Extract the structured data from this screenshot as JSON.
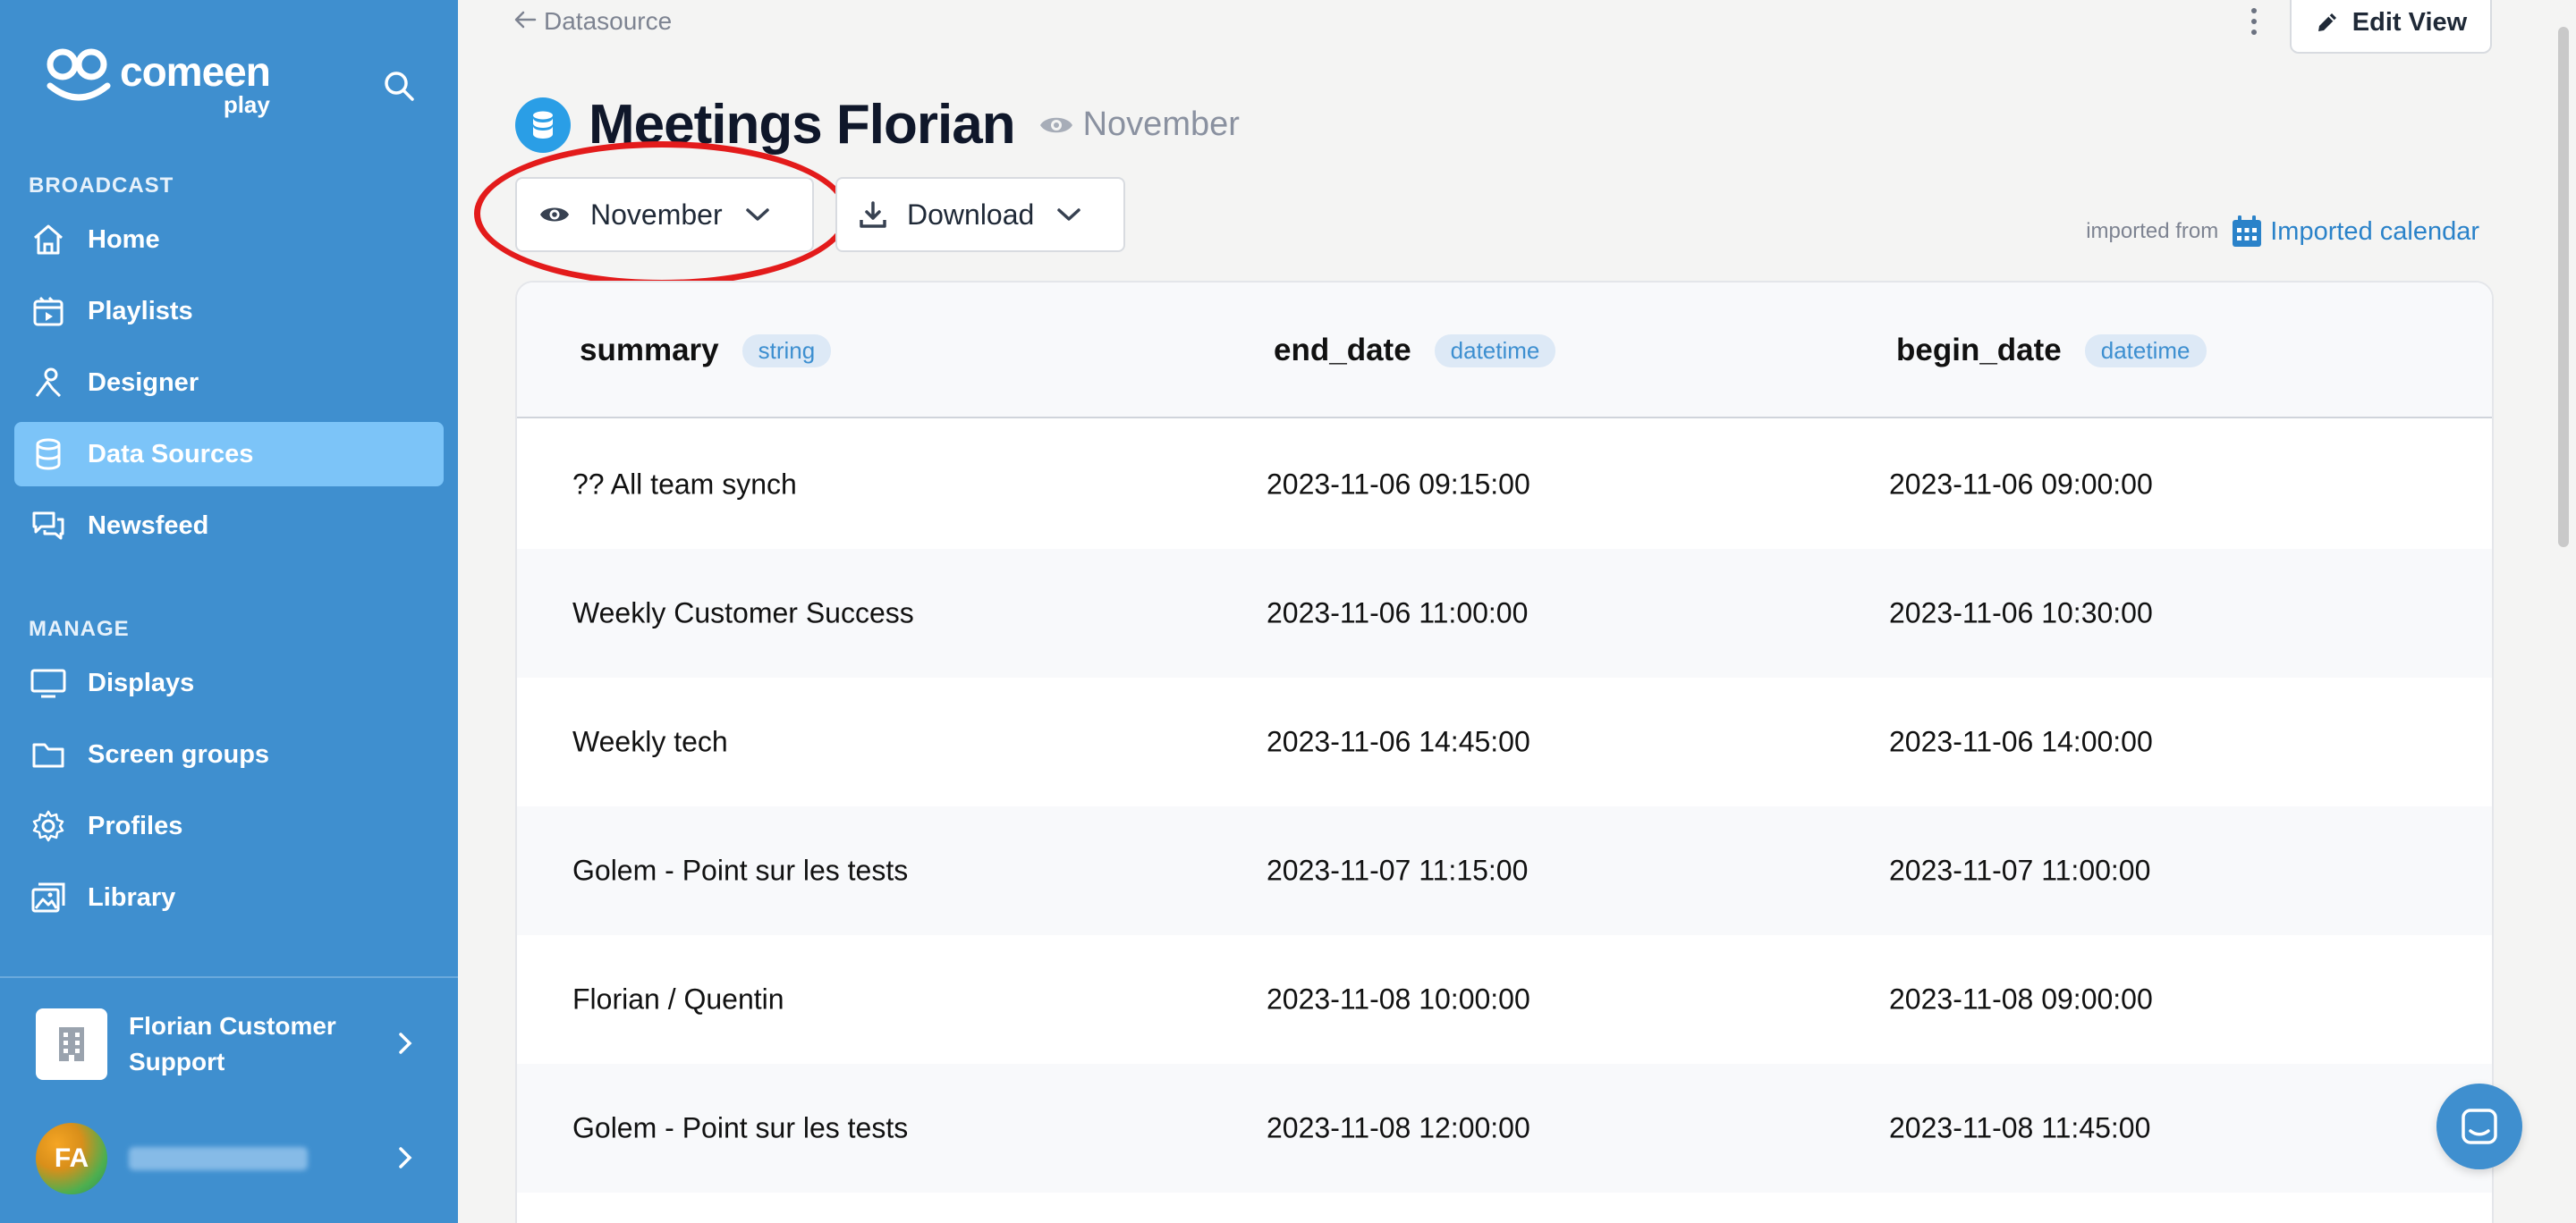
{
  "brand": {
    "name": "comeen",
    "sub": "play"
  },
  "sidebar": {
    "sections": [
      {
        "label": "BROADCAST"
      },
      {
        "label": "MANAGE"
      }
    ],
    "items": [
      {
        "label": "Home",
        "icon": "home-icon"
      },
      {
        "label": "Playlists",
        "icon": "playlist-icon"
      },
      {
        "label": "Designer",
        "icon": "designer-icon"
      },
      {
        "label": "Data Sources",
        "icon": "database-icon"
      },
      {
        "label": "Newsfeed",
        "icon": "chat-bubbles-icon"
      },
      {
        "label": "Displays",
        "icon": "monitor-icon"
      },
      {
        "label": "Screen groups",
        "icon": "folder-icon"
      },
      {
        "label": "Profiles",
        "icon": "gear-icon"
      },
      {
        "label": "Library",
        "icon": "image-library-icon"
      }
    ],
    "organization": {
      "name": "Florian Customer Support",
      "icon": "building-icon"
    },
    "user": {
      "initials": "FA"
    }
  },
  "header": {
    "back_label": "Datasource",
    "edit_label": "Edit View",
    "title": "Meetings Florian",
    "view_hint": "November"
  },
  "toolbar": {
    "view_label": "November",
    "download_label": "Download",
    "imported_from_label": "imported from",
    "imported_source": "Imported calendar"
  },
  "table": {
    "columns": [
      {
        "name": "summary",
        "type": "string"
      },
      {
        "name": "end_date",
        "type": "datetime"
      },
      {
        "name": "begin_date",
        "type": "datetime"
      }
    ],
    "rows": [
      [
        "?? All team synch",
        "2023-11-06 09:15:00",
        "2023-11-06 09:00:00"
      ],
      [
        "Weekly Customer Success",
        "2023-11-06 11:00:00",
        "2023-11-06 10:30:00"
      ],
      [
        "Weekly tech",
        "2023-11-06 14:45:00",
        "2023-11-06 14:00:00"
      ],
      [
        "Golem - Point sur les tests",
        "2023-11-07 11:15:00",
        "2023-11-07 11:00:00"
      ],
      [
        "Florian / Quentin",
        "2023-11-08 10:00:00",
        "2023-11-08 09:00:00"
      ],
      [
        "Golem - Point sur les tests",
        "2023-11-08 12:00:00",
        "2023-11-08 11:45:00"
      ]
    ]
  },
  "colors": {
    "sidebar": "#3f8fcf",
    "active_item": "#7cc4f8",
    "accent": "#2a9ee6",
    "highlight": "#e31b1b"
  }
}
